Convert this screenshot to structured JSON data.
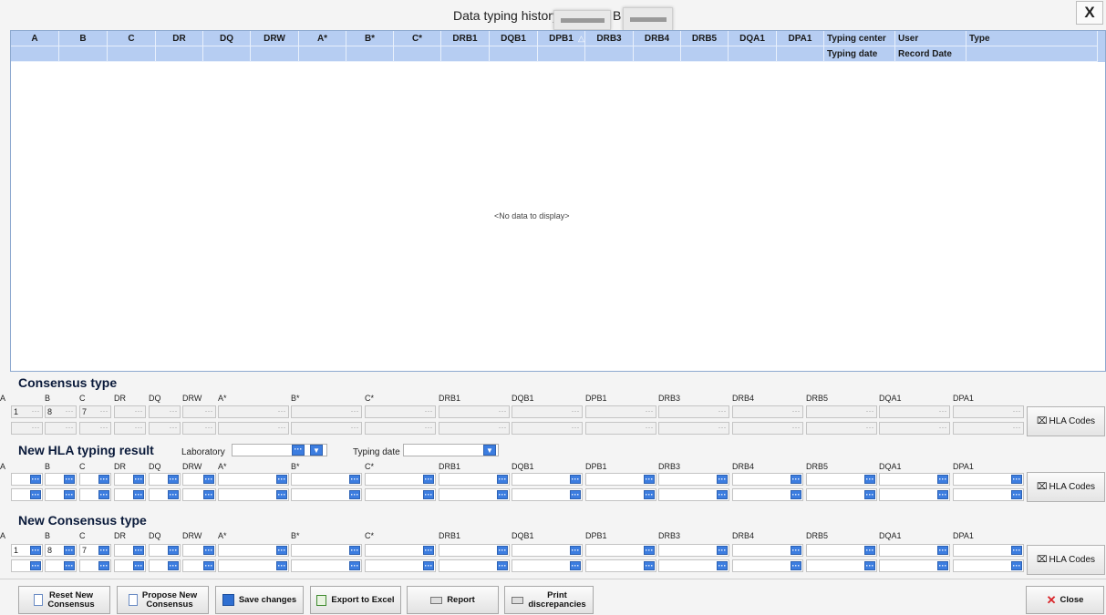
{
  "window": {
    "title": "Data typing history",
    "title_suffix": "B",
    "close_glyph": "X"
  },
  "grid": {
    "columns": [
      "A",
      "B",
      "C",
      "DR",
      "DQ",
      "DRW",
      "A*",
      "B*",
      "C*",
      "DRB1",
      "DQB1",
      "DPB1",
      "DRB3",
      "DRB4",
      "DRB5",
      "DQA1",
      "DPA1",
      "Typing center",
      "User",
      "Type"
    ],
    "sub_columns": [
      "Typing date",
      "Record Date"
    ],
    "sorted_column": "DPB1",
    "sort_glyph": "△",
    "empty_text": "<No data to display>"
  },
  "loci": [
    "A",
    "B",
    "C",
    "DR",
    "DQ",
    "DRW",
    "A*",
    "B*",
    "C*",
    "DRB1",
    "DQB1",
    "DPB1",
    "DRB3",
    "DRB4",
    "DRB5",
    "DQA1",
    "DPA1"
  ],
  "consensus": {
    "title": "Consensus type",
    "row1_values": [
      "1",
      "8",
      "7"
    ],
    "hla_codes_label": "HLA Codes"
  },
  "new_typing": {
    "title": "New HLA typing result",
    "laboratory_label": "Laboratory",
    "laboratory_value": "",
    "typing_date_label": "Typing date",
    "typing_date_value": "",
    "hla_codes_label": "HLA Codes"
  },
  "new_consensus": {
    "title": "New Consensus type",
    "row1_values": [
      "1",
      "8",
      "7"
    ],
    "hla_codes_label": "HLA Codes"
  },
  "buttons": {
    "reset_line1": "Reset New",
    "reset_line2": "Consensus",
    "propose_line1": "Propose New",
    "propose_line2": "Consensus",
    "save": "Save changes",
    "export": "Export to Excel",
    "report": "Report",
    "print_line1": "Print",
    "print_line2": "discrepancies",
    "close": "Close"
  },
  "colors": {
    "grid_header": "#b6cdf2",
    "accent_blue": "#3c7de0",
    "close_red": "#d9262b"
  }
}
